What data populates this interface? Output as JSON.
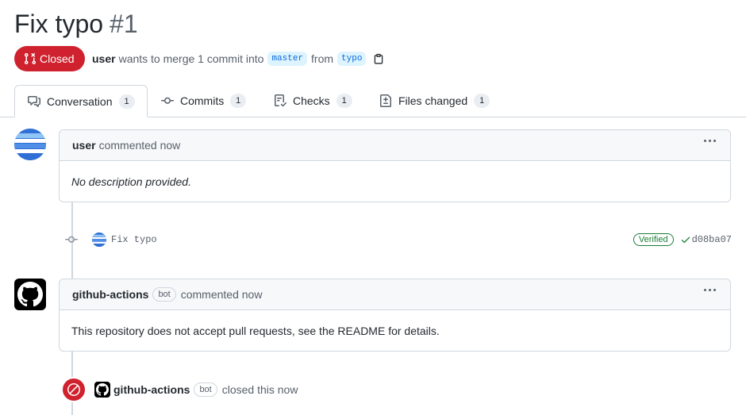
{
  "pr": {
    "title": "Fix typo",
    "number": "#1",
    "state": "Closed",
    "author": "user",
    "merge_text_1": "wants to merge 1 commit into",
    "base_branch": "master",
    "merge_text_2": "from",
    "head_branch": "typo"
  },
  "tabs": [
    {
      "label": "Conversation",
      "count": "1",
      "icon": "comment-discussion-icon"
    },
    {
      "label": "Commits",
      "count": "1",
      "icon": "git-commit-icon"
    },
    {
      "label": "Checks",
      "count": "1",
      "icon": "checklist-icon"
    },
    {
      "label": "Files changed",
      "count": "1",
      "icon": "file-diff-icon"
    }
  ],
  "timeline": {
    "comment1": {
      "author": "user",
      "action": "commented now",
      "body": "No description provided."
    },
    "commit": {
      "message": "Fix typo",
      "verified": "Verified",
      "sha": "d08ba07"
    },
    "comment2": {
      "author": "github-actions",
      "bot_label": "bot",
      "action": "commented now",
      "body": "This repository does not accept pull requests, see the README for details."
    },
    "closed_event": {
      "actor": "github-actions",
      "bot_label": "bot",
      "action": "closed this now"
    }
  },
  "colors": {
    "closed": "#cf222e",
    "link": "#0969da",
    "verified": "#1a7f37"
  }
}
